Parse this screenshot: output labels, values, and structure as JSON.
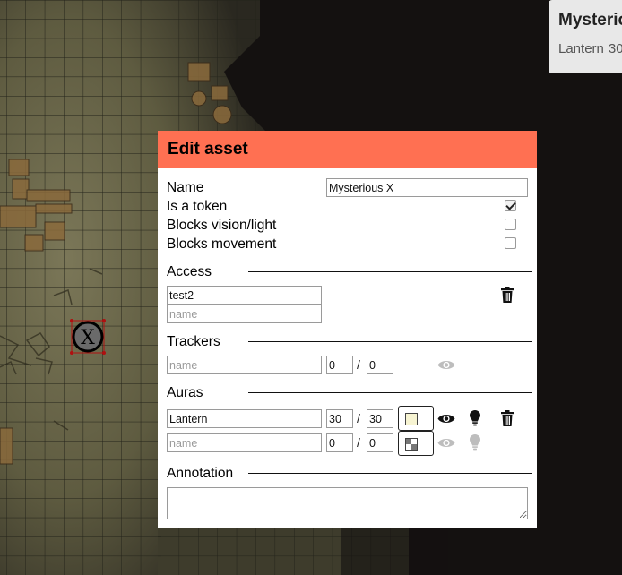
{
  "info_card": {
    "title": "Mysterious X",
    "aura_name": "Lantern",
    "aura_value": "30"
  },
  "token": {
    "glyph": "X"
  },
  "modal": {
    "title": "Edit asset",
    "fields": {
      "name_label": "Name",
      "name_value": "Mysterious X",
      "is_token_label": "Is a token",
      "is_token": true,
      "blocks_vision_label": "Blocks vision/light",
      "blocks_vision": false,
      "blocks_movement_label": "Blocks movement",
      "blocks_movement": false
    },
    "access": {
      "heading": "Access",
      "entries": [
        "test2"
      ],
      "new_placeholder": "name"
    },
    "trackers": {
      "heading": "Trackers",
      "new": {
        "name_placeholder": "name",
        "value": "0",
        "max": "0"
      }
    },
    "auras": {
      "heading": "Auras",
      "rows": [
        {
          "name": "Lantern",
          "value": "30",
          "dim": "30",
          "color": "#f7f4d2",
          "visible": true,
          "light": true
        },
        {
          "name": "",
          "name_placeholder": "name",
          "value": "0",
          "dim": "0",
          "color": "checker",
          "visible": false,
          "light": false
        }
      ]
    },
    "annotation": {
      "heading": "Annotation",
      "value": ""
    },
    "slash": "/"
  },
  "colors": {
    "header": "#ff7052",
    "modal_bg": "#ffffff",
    "map_paper": "#6e6a4c",
    "grid": "#2a2a20",
    "void": "#141110"
  }
}
